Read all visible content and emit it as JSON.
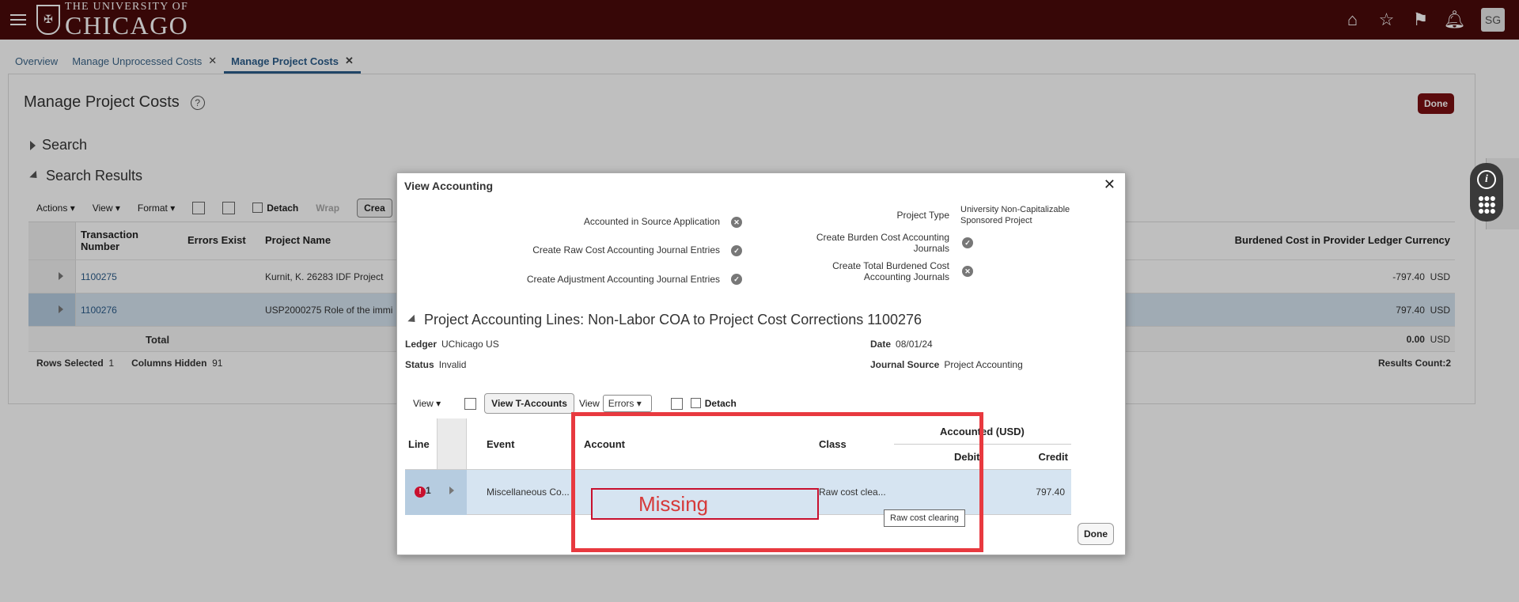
{
  "header": {
    "logo_line1": "THE UNIVERSITY OF",
    "logo_line2": "CHICAGO",
    "avatar": "SG",
    "icons": [
      "home-icon",
      "star-icon",
      "flag-icon",
      "bell-icon"
    ]
  },
  "tabs": [
    {
      "label": "Overview",
      "closable": false,
      "active": false
    },
    {
      "label": "Manage Unprocessed Costs",
      "closable": true,
      "active": false
    },
    {
      "label": "Manage Project Costs",
      "closable": true,
      "active": true
    }
  ],
  "page": {
    "title": "Manage Project Costs",
    "done_label": "Done",
    "search_label": "Search",
    "results_label": "Search Results",
    "toolbar": {
      "actions": "Actions",
      "view": "View",
      "format": "Format",
      "detach": "Detach",
      "wrap": "Wrap",
      "create": "Crea"
    },
    "columns": {
      "txn": "Transaction Number",
      "errors": "Errors Exist",
      "project": "Project Name",
      "burdened": "Burdened Cost in Provider Ledger Currency"
    },
    "rows": [
      {
        "txn": "1100275",
        "project": "Kurnit, K. 26283 IDF Project",
        "amount": "-797.40",
        "currency": "USD"
      },
      {
        "txn": "1100276",
        "project": "USP2000275 Role of the immi",
        "amount": "797.40",
        "currency": "USD"
      }
    ],
    "total_label": "Total",
    "total_amount": "0.00",
    "total_currency": "USD",
    "rows_selected_label": "Rows Selected",
    "rows_selected": "1",
    "columns_hidden_label": "Columns Hidden",
    "columns_hidden": "91",
    "results_count": "Results Count:2"
  },
  "modal": {
    "title": "View Accounting",
    "left_items": [
      {
        "label": "Accounted in Source Application",
        "status": "x"
      },
      {
        "label": "Create Raw Cost Accounting Journal Entries",
        "status": "check"
      },
      {
        "label": "Create Adjustment Accounting Journal Entries",
        "status": "check"
      }
    ],
    "project_type_label": "Project Type",
    "project_type_line1": "University Non-Capitalizable",
    "project_type_line2": "Sponsored Project",
    "right_items": [
      {
        "label_line1": "Create Burden Cost Accounting",
        "label_line2": "Journals",
        "status": "check"
      },
      {
        "label_line1": "Create Total Burdened Cost",
        "label_line2": "Accounting Journals",
        "status": "x"
      }
    ],
    "section_title": "Project Accounting Lines: Non-Labor COA to Project Cost Corrections 1100276",
    "ledger_label": "Ledger",
    "ledger": "UChicago US",
    "status_label": "Status",
    "status": "Invalid",
    "date_label": "Date",
    "date": "08/01/24",
    "journal_source_label": "Journal Source",
    "journal_source": "Project Accounting",
    "toolbar": {
      "view": "View",
      "view_t_accounts": "View T-Accounts",
      "view2": "View",
      "errors_select": "Errors",
      "detach": "Detach"
    },
    "grid": {
      "col_line": "Line",
      "col_event": "Event",
      "col_account": "Account",
      "col_class": "Class",
      "col_accounted": "Accounted (USD)",
      "col_debit": "Debit",
      "col_credit": "Credit",
      "row": {
        "line": "1",
        "event": "Miscellaneous Co...",
        "account_annotation": "Missing",
        "class": "Raw cost clea...",
        "debit": "",
        "credit": "797.40"
      }
    },
    "tooltip": "Raw cost clearing",
    "done_label": "Done"
  }
}
